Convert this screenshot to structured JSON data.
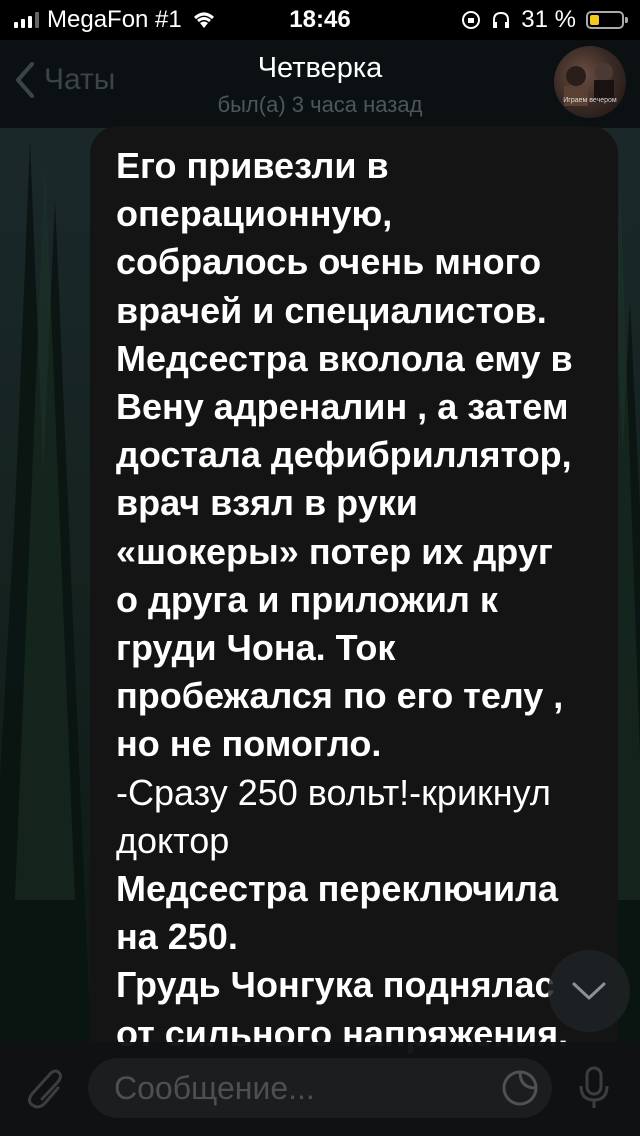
{
  "status_bar": {
    "carrier": "MegaFon #1",
    "time": "18:46",
    "battery_percent": "31 %",
    "battery_level": 0.31,
    "battery_color": "#f4c81c"
  },
  "header": {
    "back_label": "Чаты",
    "title": "Четверка",
    "subtitle": "был(а) 3 часа назад",
    "avatar_caption": "Играем вечером"
  },
  "message": {
    "part1": "Его привезли в\nоперационную,\nсобралось очень много\nврачей и специалистов.\nМедсестра вколола ему в\nВену адреналин , а затем\nдостала дефибриллятор,\nврач взял в руки\n«шокеры» потер их друг\nо друга и приложил к\nгруди Чона. Ток\nпробежался по его телу ,\nно не помогло.",
    "part2": "-Сразу 250 вольт!-крикнул\nдоктор",
    "part3": "Медсестра переключила\nна 250.\nГрудь Чонгука поднялас\nот сильного напряжения."
  },
  "composer": {
    "placeholder": "Сообщение..."
  },
  "icons": {
    "back": "chevron-left-icon",
    "attach": "paperclip-icon",
    "sticker": "sticker-icon",
    "mic": "microphone-icon",
    "scroll": "chevron-down-icon"
  }
}
